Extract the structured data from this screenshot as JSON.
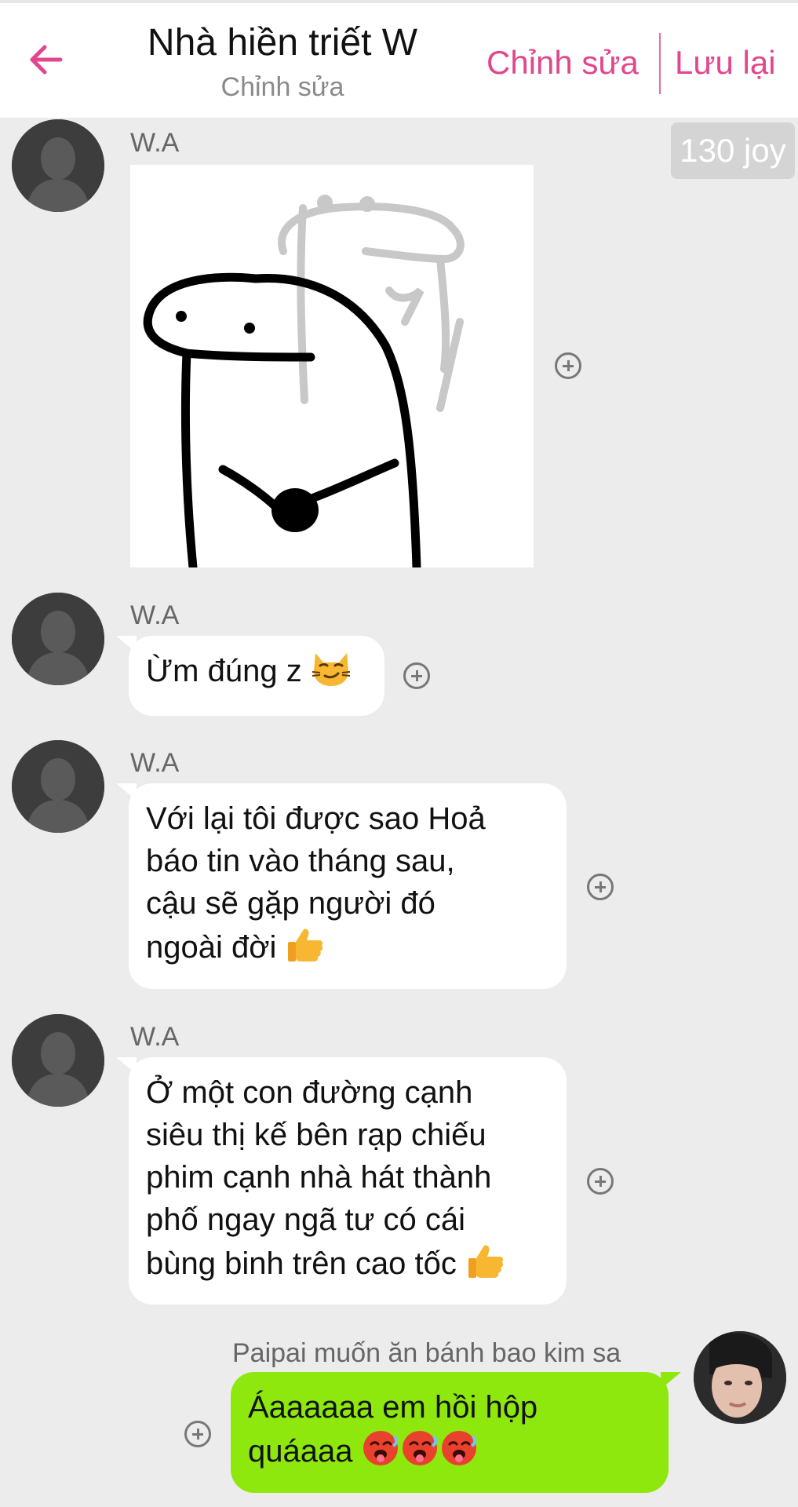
{
  "header": {
    "title": "Nhà hiền triết W",
    "subtitle": "Chỉnh sửa",
    "edit_label": "Chỉnh sửa",
    "save_label": "Lưu lại",
    "accent_color": "#e0478c"
  },
  "joy_badge": "130 joy",
  "messages": [
    {
      "sender": "W.A",
      "type": "sticker",
      "icon": "blob-sticker"
    },
    {
      "sender": "W.A",
      "text": "Ừm đúng z",
      "emoji": "smirking-cat-face"
    },
    {
      "sender": "W.A",
      "lines": [
        "Với lại tôi được sao Hoả",
        "báo tin vào tháng sau,",
        "cậu sẽ gặp người đó",
        "ngoài đời"
      ],
      "emoji": "thumbs-up"
    },
    {
      "sender": "W.A",
      "lines": [
        "Ở một con đường cạnh",
        "siêu thị kế bên rạp chiếu",
        "phim cạnh nhà hát thành",
        "phố ngay ngã tư có cái",
        "bùng binh trên cao tốc"
      ],
      "emoji": "thumbs-up"
    }
  ],
  "my_message": {
    "sender": "Paipai muốn ăn bánh bao kim sa",
    "lines": [
      "Áaaaaaa em hồi hộp",
      "quáaaa"
    ],
    "emoji": "hot-face",
    "bubble_color": "#8ee80d"
  }
}
